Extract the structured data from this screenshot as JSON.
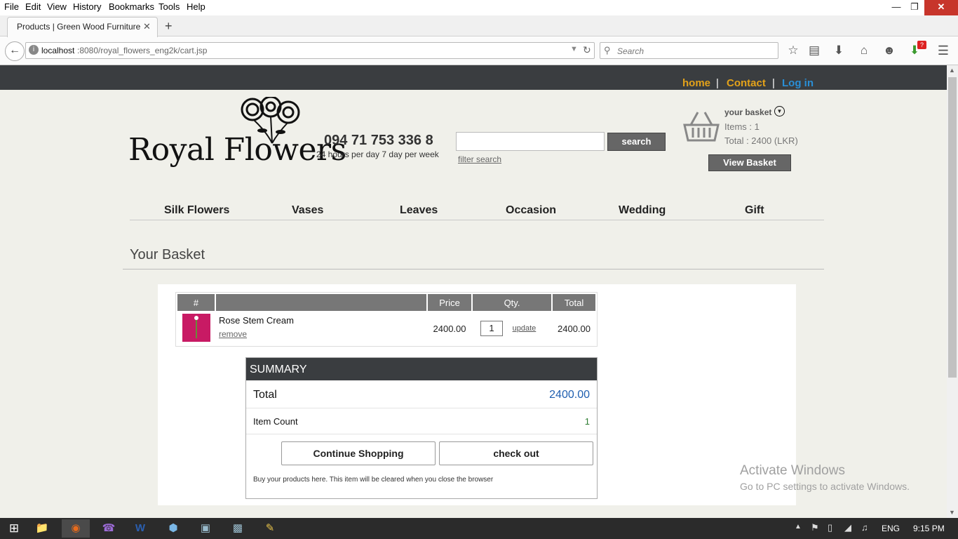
{
  "browser": {
    "menu": [
      "File",
      "Edit",
      "View",
      "History",
      "Bookmarks",
      "Tools",
      "Help"
    ],
    "tab_title": "Products | Green Wood Furniture",
    "url_host": "localhost",
    "url_rest": ":8080/royal_flowers_eng2k/cart.jsp",
    "search_placeholder": "Search",
    "badge": "?"
  },
  "site": {
    "nav": {
      "home": "home",
      "contact": "Contact",
      "login": "Log in",
      "sep": "|"
    },
    "logo_text": "Royal Flowers",
    "phone": "094 71 753 336 8",
    "hours": "24 hours per day 7 day per week",
    "search_button": "search",
    "filter_search": "filter search",
    "basket": {
      "title": "your basket",
      "items": "Items : 1",
      "total": "Total : 2400 (LKR)",
      "view_button": "View Basket"
    },
    "categories": [
      "Silk Flowers",
      "Vases",
      "Leaves",
      "Occasion",
      "Wedding",
      "Gift"
    ],
    "page_heading": "Your Basket"
  },
  "cart": {
    "headers": [
      "#",
      "",
      "Price",
      "Qty.",
      "Total"
    ],
    "rows": [
      {
        "name": "Rose Stem Cream",
        "remove": "remove",
        "price": "2400.00",
        "qty": "1",
        "update": "update",
        "total": "2400.00"
      }
    ]
  },
  "summary": {
    "title": "SUMMARY",
    "total_label": "Total",
    "total_value": "2400.00",
    "count_label": "Item Count",
    "count_value": "1",
    "continue_button": "Continue Shopping",
    "checkout_button": "check out",
    "note": "Buy your products here. This item will be cleared when you close the browser"
  },
  "watermark": {
    "line1": "Activate Windows",
    "line2": "Go to PC settings to activate Windows."
  },
  "taskbar": {
    "lang": "ENG",
    "time": "9:15 PM"
  },
  "colors": {
    "topstrip": "#3a3d40",
    "nav_orange": "#e3a21a",
    "nav_blue": "#2a8fd6",
    "total_blue": "#1f5fb0",
    "count_green": "#2e7d32"
  }
}
